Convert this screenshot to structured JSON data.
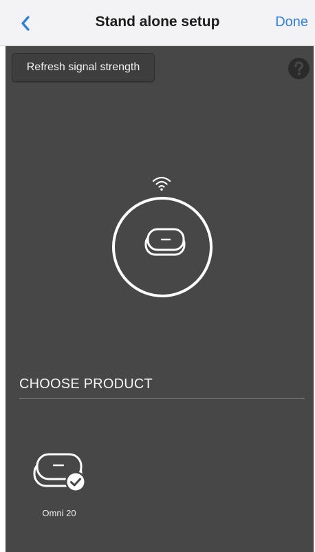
{
  "nav": {
    "title": "Stand alone setup",
    "done_label": "Done",
    "back_icon": "chevron-left-icon"
  },
  "toolbar": {
    "refresh_label": "Refresh signal strength",
    "help_icon": "question-circle-icon"
  },
  "device": {
    "signal_icon": "wifi-icon",
    "device_icon": "speaker-device-icon"
  },
  "section": {
    "title": "CHOOSE PRODUCT"
  },
  "products": [
    {
      "label": "Omni 20",
      "selected": true,
      "icon": "speaker-device-check-icon"
    }
  ],
  "colors": {
    "accent": "#2f7fde",
    "background": "#474747",
    "navbar": "#f3f3f5"
  }
}
